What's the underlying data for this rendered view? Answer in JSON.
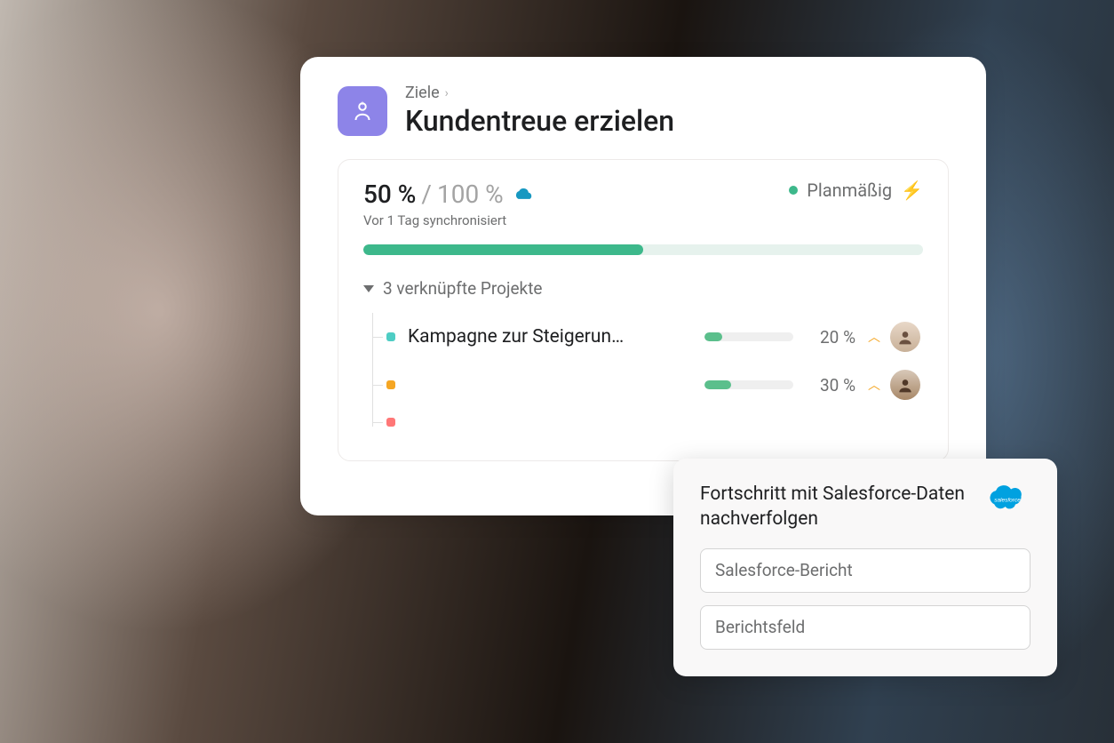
{
  "breadcrumb": {
    "label": "Ziele"
  },
  "title": "Kundentreue erzielen",
  "progress": {
    "current": "50 %",
    "target": "100 %",
    "percent": 50,
    "sync_text": "Vor 1 Tag synchronisiert",
    "status_label": "Planmäßig",
    "status_color": "#3db88b"
  },
  "linked_projects": {
    "header": "3 verknüpfte Projekte",
    "items": [
      {
        "name": "Kampagne zur Steigerun…",
        "dot": "teal",
        "percent": 20,
        "pct_label": "20 %"
      },
      {
        "name": "",
        "dot": "orange",
        "percent": 30,
        "pct_label": "30 %"
      },
      {
        "name": "",
        "dot": "red",
        "percent": null,
        "pct_label": ""
      }
    ]
  },
  "popup": {
    "title": "Fortschritt mit Salesforce-Daten nachverfolgen",
    "field1_placeholder": "Salesforce-Bericht",
    "field2_placeholder": "Berichtsfeld"
  },
  "colors": {
    "accent_purple": "#8d84e8",
    "progress_green": "#3db88b",
    "cloud_blue": "#1798c1"
  }
}
